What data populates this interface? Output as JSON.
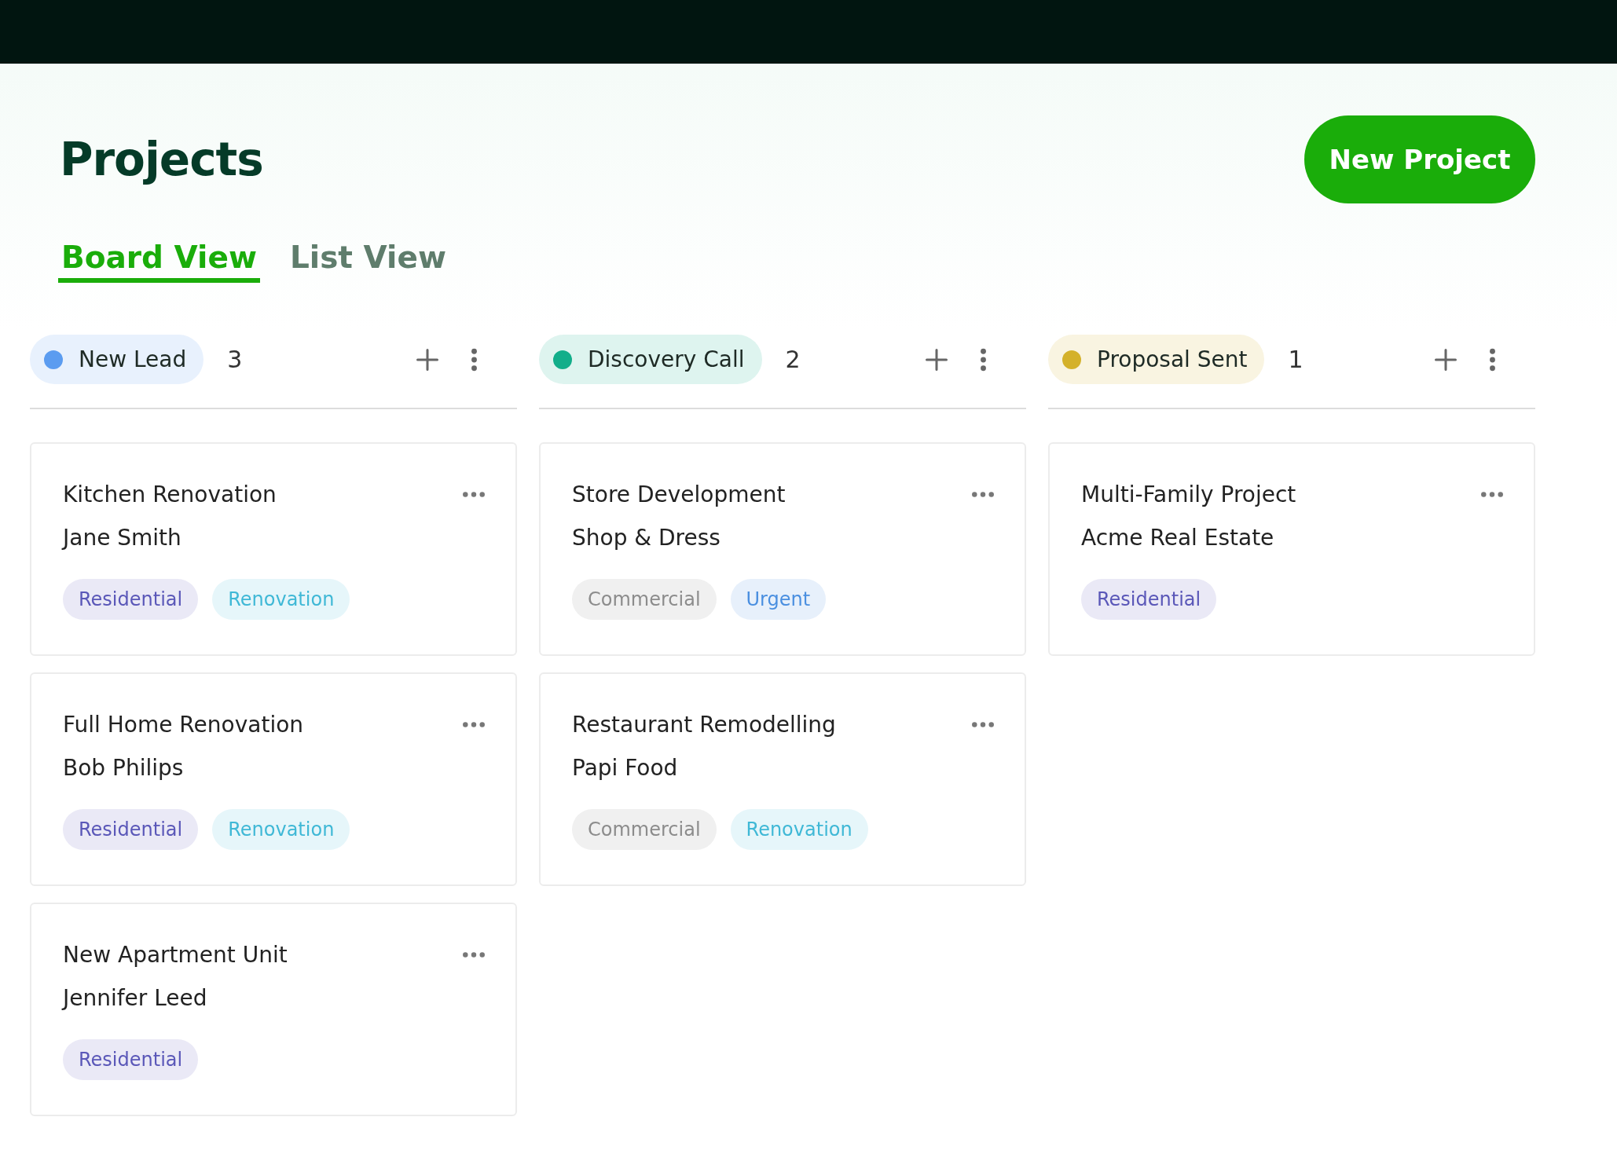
{
  "title": "Projects",
  "new_button": "New Project",
  "tabs": [
    {
      "label": "Board View",
      "selected": true
    },
    {
      "label": "List View",
      "selected": false
    }
  ],
  "columns": [
    {
      "name": "New Lead",
      "color": "#5b9cf0",
      "count": "3",
      "cards": [
        {
          "title": "Kitchen Renovation",
          "client": "Jane Smith",
          "tags": [
            {
              "label": "Residential",
              "color": "#5a57b8"
            },
            {
              "label": "Renovation",
              "color": "#3fb8d6"
            }
          ]
        },
        {
          "title": "Full Home Renovation",
          "client": "Bob Philips",
          "tags": [
            {
              "label": "Residential",
              "color": "#5a57b8"
            },
            {
              "label": "Renovation",
              "color": "#3fb8d6"
            }
          ]
        },
        {
          "title": "New Apartment Unit",
          "client": "Jennifer Leed",
          "tags": [
            {
              "label": "Residential",
              "color": "#5a57b8"
            }
          ]
        }
      ]
    },
    {
      "name": "Discovery Call",
      "color": "#12ae8a",
      "count": "2",
      "cards": [
        {
          "title": "Store Development",
          "client": "Shop & Dress",
          "tags": [
            {
              "label": "Commercial",
              "color": "#8c8c8c"
            },
            {
              "label": "Urgent",
              "color": "#4a8fe0"
            }
          ]
        },
        {
          "title": "Restaurant Remodelling",
          "client": "Papi Food",
          "tags": [
            {
              "label": "Commercial",
              "color": "#8c8c8c"
            },
            {
              "label": "Renovation",
              "color": "#3fb8d6"
            }
          ]
        }
      ]
    },
    {
      "name": "Proposal Sent",
      "color": "#d4b12a",
      "count": "1",
      "cards": [
        {
          "title": "Multi-Family Project",
          "client": "Acme Real Estate",
          "tags": [
            {
              "label": "Residential",
              "color": "#5a57b8"
            }
          ]
        }
      ]
    }
  ]
}
